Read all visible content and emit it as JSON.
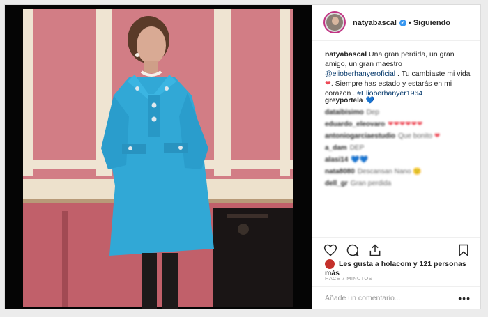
{
  "post": {
    "username": "natyabascal",
    "verified_icon": "verified-badge-icon",
    "dot": "•",
    "follow_label": "Siguiendo",
    "caption": {
      "username": "natyabascal",
      "text_1": "Una gran perdida, un gran amigo, un gran maestro ",
      "mention": "@elioberhanyeroficial",
      "text_2": " . Tu cambiaste mi vida",
      "heart": "❤",
      "text_3": ". Siempre has estado y estarás en mi corazon . ",
      "hashtag": "#Elioberhanyer1964"
    },
    "comments": [
      {
        "user": "greyportela",
        "text": "",
        "emoji": "💙"
      },
      {
        "user": "dataibisimo",
        "text": "Dep",
        "emoji": ""
      },
      {
        "user": "eduardo_eleovaro",
        "text": "",
        "emoji": "❤❤❤❤❤❤"
      },
      {
        "user": "antoniogarciaestudio",
        "text": "Que bonito",
        "emoji": "❤"
      },
      {
        "user": "a_dam",
        "text": "DEP",
        "emoji": ""
      },
      {
        "user": "alasi14",
        "text": "",
        "emoji": "💙💙"
      },
      {
        "user": "nata8080",
        "text": "Descansan Nano",
        "emoji": "🙁"
      },
      {
        "user": "dell_gr",
        "text": "Gran perdida",
        "emoji": ""
      }
    ],
    "likes": "Les gusta a holacom y 121 personas más",
    "time": "HACE 7 MINUTOS",
    "comment_placeholder": "Añade un comentario...",
    "more": "•••"
  }
}
